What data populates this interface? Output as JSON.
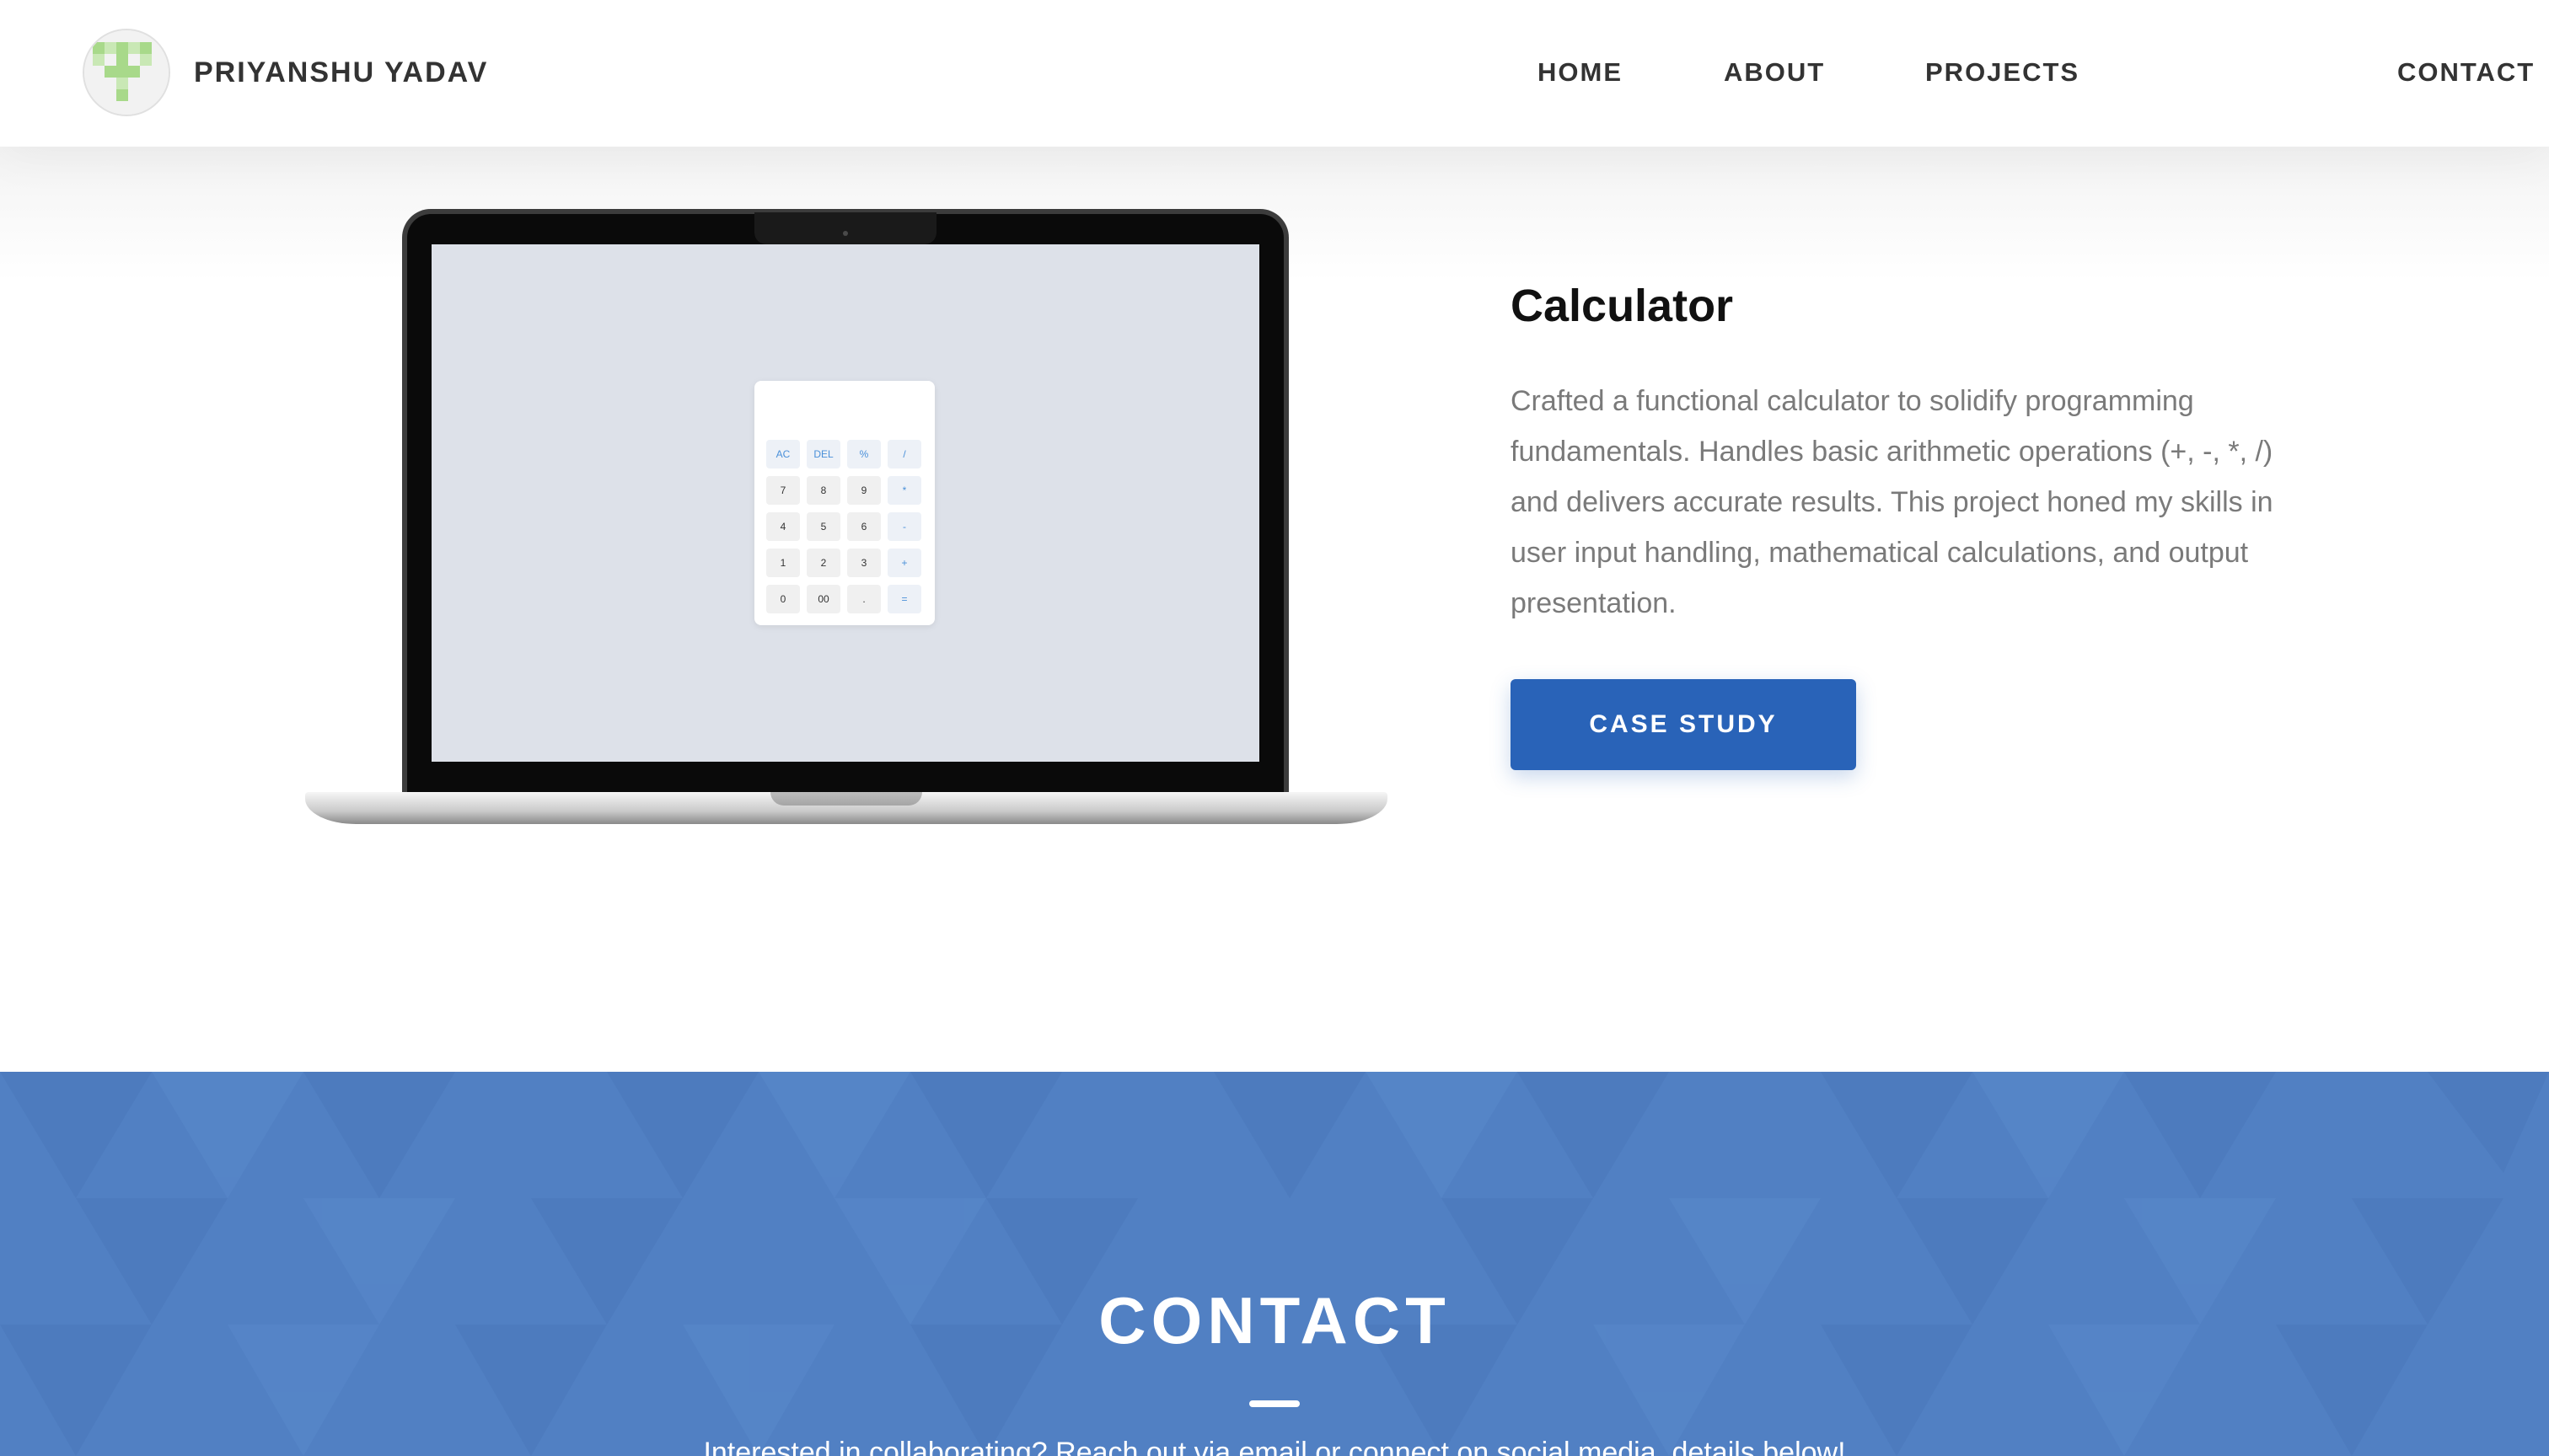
{
  "header": {
    "brand_name": "PRIYANSHU YADAV",
    "logo_icon": "pixel-letter-logo-icon",
    "nav": [
      {
        "label": "HOME"
      },
      {
        "label": "ABOUT"
      },
      {
        "label": "PROJECTS"
      },
      {
        "label": "CONTACT"
      }
    ]
  },
  "project": {
    "title": "Calculator",
    "description": "Crafted a functional calculator to solidify programming fundamentals. Handles basic arithmetic operations (+, -, *, /) and delivers accurate results. This project honed my skills in user input handling, mathematical calculations, and output presentation.",
    "button_label": "CASE STUDY",
    "mockup": {
      "device": "laptop",
      "calculator_keys": [
        "AC",
        "DEL",
        "%",
        "/",
        "7",
        "8",
        "9",
        "*",
        "4",
        "5",
        "6",
        "-",
        "1",
        "2",
        "3",
        "+",
        "0",
        "00",
        ".",
        "="
      ]
    }
  },
  "contact": {
    "heading": "CONTACT",
    "intro": "Interested in collaborating? Reach out via email or connect on social media, details below!"
  },
  "colors": {
    "accent": "#2963b8",
    "contact_bg": "#5180c3",
    "text_dark": "#333333",
    "text_muted": "#7a7a7a",
    "logo_green": "#a8d98a"
  }
}
